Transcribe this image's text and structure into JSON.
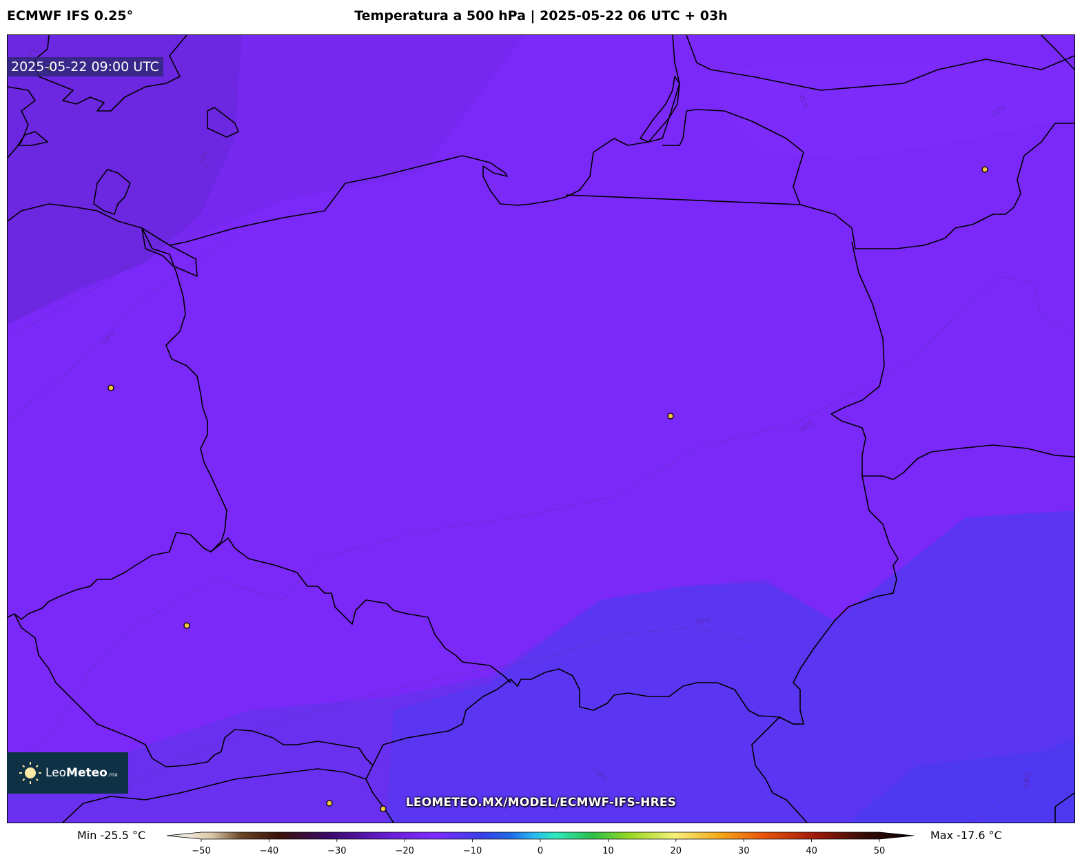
{
  "header": {
    "model": "ECMWF IFS 0.25°",
    "title": "Temperatura a 500 hPa | 2025-05-22 06 UTC + 03h"
  },
  "map": {
    "valid_time": "2025-05-22 09:00 UTC",
    "contour_labels": [
      "-24°C",
      "-23°C",
      "-22°C",
      "-21°C",
      "-21°C",
      "-20°C",
      "-19°C",
      "-18°C",
      "-18°C"
    ],
    "colors": {
      "field_cold": "#6a28e0",
      "field_mid": "#7a29fa",
      "field_warm": "#5a34f2",
      "coastline": "#000000",
      "city_marker": "#f2c744"
    },
    "cities_count": 8
  },
  "brand": {
    "logo_leo": "Leo",
    "logo_meteo": "Meteo",
    "logo_suffix": ".mx",
    "watermark": "LEOMETEO.MX/MODEL/ECMWF-IFS-HRES"
  },
  "colorbar": {
    "min_label": "Min -25.5 °C",
    "max_label": "Max -17.6 °C",
    "ticks": [
      "−50",
      "−40",
      "−30",
      "−20",
      "−10",
      "0",
      "10",
      "20",
      "30",
      "40",
      "50"
    ],
    "range": [
      -50,
      50
    ]
  }
}
